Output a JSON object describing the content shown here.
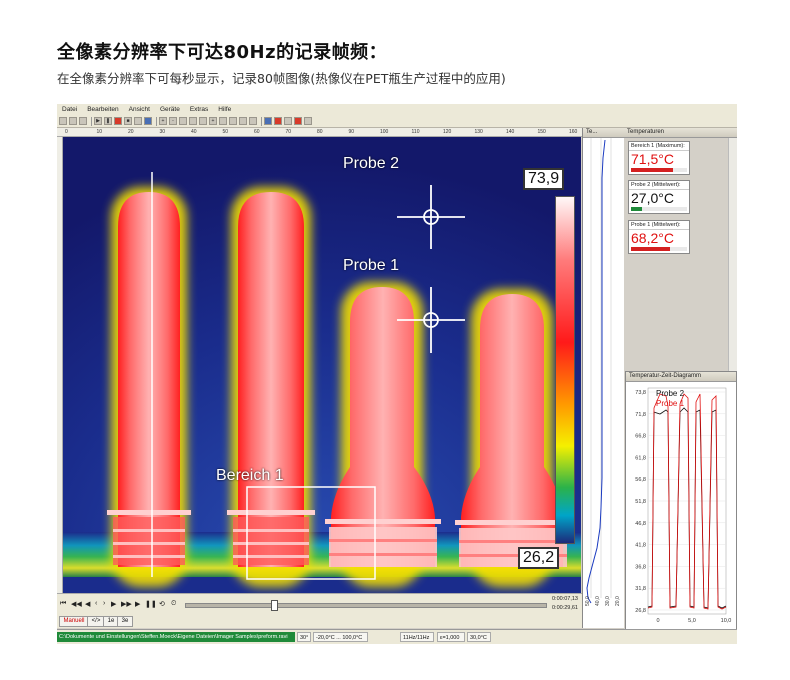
{
  "heading": {
    "title": "全像素分辨率下可达80Hz的记录帧频：",
    "subtitle": "在全像素分辨率下可每秒显示，记录80帧图像(热像仪在PET瓶生产过程中的应用)"
  },
  "app": {
    "menu": [
      "Datei",
      "Bearbeiten",
      "Ansicht",
      "Geräte",
      "Extras",
      "Hilfe"
    ],
    "ruler_ticks": [
      "0",
      "10",
      "20",
      "30",
      "40",
      "50",
      "60",
      "70",
      "80",
      "90",
      "100",
      "110",
      "120",
      "130",
      "140",
      "150",
      "160"
    ],
    "image": {
      "probe2_label": "Probe 2",
      "probe1_label": "Probe 1",
      "region_label": "Bereich 1",
      "scale_max": "73,9",
      "scale_min": "26,2"
    },
    "profile_header": "Te...",
    "profile_axis": [
      "50,0",
      "40,0",
      "30,0",
      "20,0"
    ],
    "temperatures_panel": {
      "title": "Temperaturen",
      "items": [
        {
          "label": "Bereich 1 (Maximum):",
          "value": "71,5°C",
          "color": "#e01010",
          "bar_color": "#d42020",
          "bar_level": 0.75
        },
        {
          "label": "Probe 2 (Mittelwert):",
          "value": "27,0°C",
          "color": "#111111",
          "bar_color": "#1f8a39",
          "bar_level": 0.2
        },
        {
          "label": "Probe 1 (Mittelwert):",
          "value": "68,2°C",
          "color": "#e01010",
          "bar_color": "#d42020",
          "bar_level": 0.7
        }
      ]
    },
    "diagram": {
      "title": "Temperatur-Zeit-Diagramm",
      "y_ticks": [
        "73,8",
        "71,8",
        "66,8",
        "61,8",
        "56,8",
        "51,8",
        "46,8",
        "41,8",
        "36,8",
        "31,8",
        "26,8"
      ],
      "x_ticks": [
        "0",
        "5,0",
        "10,0"
      ],
      "legend": [
        "Probe 2",
        "Probe 1"
      ]
    },
    "transport": {
      "time_total": "0:00:07,13",
      "time_pos": "0:00:29,61"
    },
    "subtabs": [
      "Manuell",
      "</>",
      "1e",
      "3e"
    ],
    "status": {
      "path": "C:\\Dokumente und Einstellungen\\Steffen.Moeck\\Eigene Dateien\\Imager Samples\\preform.ravi",
      "fov": "30°",
      "range": "-20,0°C ... 100,0°C",
      "rate": "11Hz/11Hz",
      "emissivity": "ε=1,000",
      "temp": "30,0°C"
    }
  }
}
